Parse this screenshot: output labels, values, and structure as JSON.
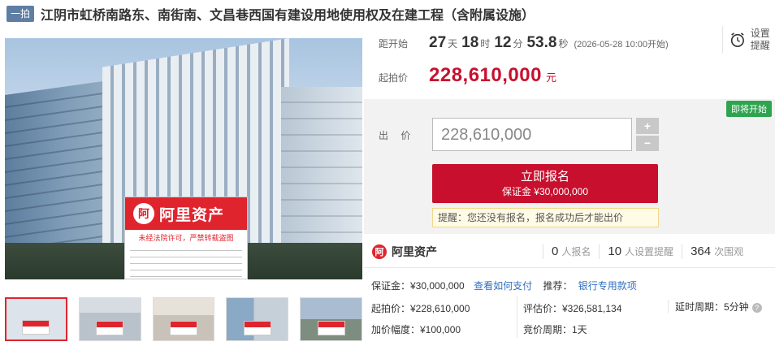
{
  "title": {
    "badge": "一拍",
    "text": "江阴市虹桥南路东、南街南、文昌巷西国有建设用地使用权及在建工程（含附属设施）"
  },
  "main_image": {
    "card_brand": "阿里资产",
    "card_warning": "未经法院许可，严禁转载盗图"
  },
  "countdown": {
    "label": "距开始",
    "days": "27",
    "days_unit": "天",
    "hours": "18",
    "hours_unit": "时",
    "minutes": "12",
    "minutes_unit": "分",
    "seconds": "53.8",
    "seconds_unit": "秒",
    "start_note": "(2026-05-28 10:00开始)"
  },
  "remind": {
    "label": "设置提醒"
  },
  "start_price": {
    "label": "起拍价",
    "value": "228,610,000",
    "unit": "元"
  },
  "bid": {
    "status_tag": "即将开始",
    "label": "出 价",
    "input_value": "228,610,000",
    "plus": "+",
    "minus": "−",
    "signup_main": "立即报名",
    "signup_sub": "保证金 ¥30,000,000",
    "hint": "提醒：您还没有报名，报名成功后才能出价"
  },
  "stats": {
    "brand": "阿里资产",
    "signups_num": "0",
    "signups_txt": "人报名",
    "reminders_num": "10",
    "reminders_txt": "人设置提醒",
    "views_num": "364",
    "views_txt": "次围观"
  },
  "details": {
    "deposit": "保证金：¥30,000,000",
    "pay_link": "查看如何支付",
    "recommend_label": "推荐：",
    "recommend_link": "银行专用款项",
    "start_price": "起拍价：¥228,610,000",
    "appraisal": "评估价：¥326,581,134",
    "delay": "延时周期：5分钟",
    "increment": "加价幅度：¥100,000",
    "cycle": "竞价周期：1天"
  },
  "colors": {
    "accent": "#c8102e",
    "brand_red": "#e0242e",
    "link": "#2f6fbf",
    "status_green": "#2ea44f"
  }
}
